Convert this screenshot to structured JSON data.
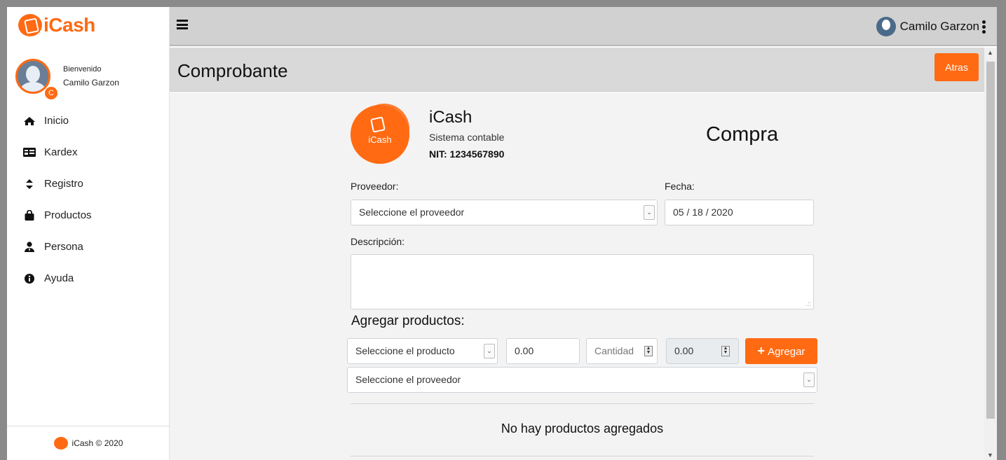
{
  "brand": {
    "name": "iCash"
  },
  "user": {
    "welcome": "Bienvenido",
    "name": "Camilo Garzon",
    "initial": "C"
  },
  "nav": {
    "items": [
      {
        "label": "Inicio",
        "icon": "home-icon"
      },
      {
        "label": "Kardex",
        "icon": "id-card-icon"
      },
      {
        "label": "Registro",
        "icon": "sort-icon"
      },
      {
        "label": "Productos",
        "icon": "shopping-bag-icon"
      },
      {
        "label": "Persona",
        "icon": "user-tie-icon"
      },
      {
        "label": "Ayuda",
        "icon": "info-circle-icon"
      }
    ]
  },
  "footer": {
    "text": "iCash © 2020"
  },
  "topbar": {
    "user_name": "Camilo Garzon"
  },
  "page": {
    "title": "Comprobante",
    "back_label": "Atras"
  },
  "company": {
    "name": "iCash",
    "subtitle": "Sistema contable",
    "nit": "NIT: 1234567890",
    "logo_text": "iCash"
  },
  "document": {
    "type": "Compra"
  },
  "form": {
    "proveedor_label": "Proveedor:",
    "proveedor_value": "Seleccione el proveedor",
    "fecha_label": "Fecha:",
    "fecha_value": "05 / 18 / 2020",
    "descripcion_label": "Descripción:",
    "descripcion_value": ""
  },
  "products": {
    "heading": "Agregar productos:",
    "product_select": "Seleccione el producto",
    "price": "0.00",
    "quantity_placeholder": "Cantidad",
    "total": "0.00",
    "add_label": "Agregar",
    "provider_select": "Seleccione el proveedor",
    "empty_message": "No hay productos agregados"
  },
  "colors": {
    "accent": "#ff6a13",
    "topbar": "#d1d1d1",
    "header": "#d9d9d9",
    "content_bg": "#f3f3f3"
  }
}
